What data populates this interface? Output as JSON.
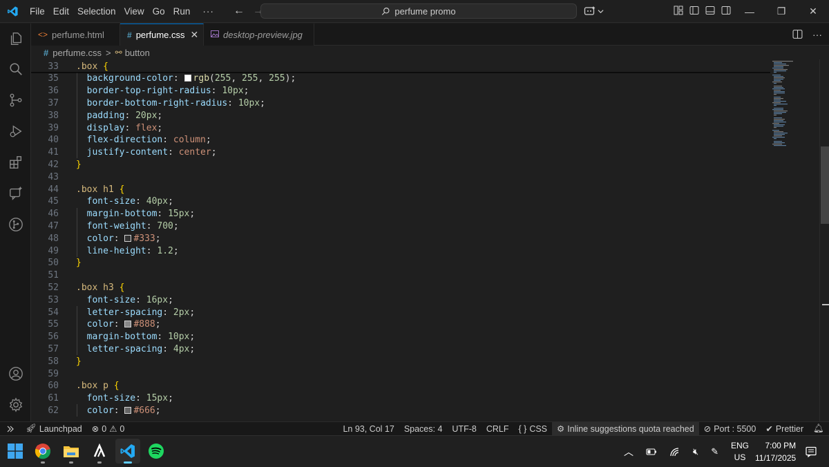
{
  "menu": [
    "File",
    "Edit",
    "Selection",
    "View",
    "Go",
    "Run"
  ],
  "menu_more": "···",
  "search": {
    "text": "perfume promo"
  },
  "tabs": [
    {
      "icon": "<>",
      "label": "perfume.html",
      "active": false
    },
    {
      "icon": "#",
      "label": "perfume.css",
      "active": true,
      "close": "✕"
    },
    {
      "icon": "img",
      "label": "desktop-preview.jpg",
      "active": false
    }
  ],
  "breadcrumb": {
    "icon": "#",
    "file": "perfume.css",
    "sep": ">",
    "symbol": "button"
  },
  "colors": {
    "accent": "#0078d4",
    "editor_bg": "#1f1f1f",
    "selector": "#d7ba7d",
    "property": "#9cdcfe",
    "value": "#ce9178",
    "number": "#b5cea8"
  },
  "code_lines": [
    {
      "n": "33",
      "sticky": true,
      "tokens": [
        [
          "sel",
          ".box "
        ],
        [
          "brace",
          "{"
        ]
      ]
    },
    {
      "n": "35",
      "tokens": [
        [
          "prop",
          "  background-color"
        ],
        [
          "punc",
          ": "
        ],
        [
          "swatch",
          "#ffffff"
        ],
        [
          "fn",
          "rgb"
        ],
        [
          "punc",
          "("
        ],
        [
          "num",
          "255"
        ],
        [
          "punc",
          ", "
        ],
        [
          "num",
          "255"
        ],
        [
          "punc",
          ", "
        ],
        [
          "num",
          "255"
        ],
        [
          "punc",
          ");"
        ]
      ]
    },
    {
      "n": "36",
      "tokens": [
        [
          "prop",
          "  border-top-right-radius"
        ],
        [
          "punc",
          ": "
        ],
        [
          "num",
          "10px"
        ],
        [
          "punc",
          ";"
        ]
      ]
    },
    {
      "n": "37",
      "tokens": [
        [
          "prop",
          "  border-bottom-right-radius"
        ],
        [
          "punc",
          ": "
        ],
        [
          "num",
          "10px"
        ],
        [
          "punc",
          ";"
        ]
      ]
    },
    {
      "n": "38",
      "tokens": [
        [
          "prop",
          "  padding"
        ],
        [
          "punc",
          ": "
        ],
        [
          "num",
          "20px"
        ],
        [
          "punc",
          ";"
        ]
      ]
    },
    {
      "n": "39",
      "tokens": [
        [
          "prop",
          "  display"
        ],
        [
          "punc",
          ": "
        ],
        [
          "val",
          "flex"
        ],
        [
          "punc",
          ";"
        ]
      ]
    },
    {
      "n": "40",
      "tokens": [
        [
          "prop",
          "  flex-direction"
        ],
        [
          "punc",
          ": "
        ],
        [
          "val",
          "column"
        ],
        [
          "punc",
          ";"
        ]
      ]
    },
    {
      "n": "41",
      "tokens": [
        [
          "prop",
          "  justify-content"
        ],
        [
          "punc",
          ": "
        ],
        [
          "val",
          "center"
        ],
        [
          "punc",
          ";"
        ]
      ]
    },
    {
      "n": "42",
      "tokens": [
        [
          "brace",
          "}"
        ]
      ]
    },
    {
      "n": "43",
      "tokens": []
    },
    {
      "n": "44",
      "tokens": [
        [
          "sel",
          ".box h1 "
        ],
        [
          "brace",
          "{"
        ]
      ]
    },
    {
      "n": "45",
      "tokens": [
        [
          "prop",
          "  font-size"
        ],
        [
          "punc",
          ": "
        ],
        [
          "num",
          "40px"
        ],
        [
          "punc",
          ";"
        ]
      ]
    },
    {
      "n": "46",
      "tokens": [
        [
          "prop",
          "  margin-bottom"
        ],
        [
          "punc",
          ": "
        ],
        [
          "num",
          "15px"
        ],
        [
          "punc",
          ";"
        ]
      ]
    },
    {
      "n": "47",
      "tokens": [
        [
          "prop",
          "  font-weight"
        ],
        [
          "punc",
          ": "
        ],
        [
          "num",
          "700"
        ],
        [
          "punc",
          ";"
        ]
      ]
    },
    {
      "n": "48",
      "tokens": [
        [
          "prop",
          "  color"
        ],
        [
          "punc",
          ": "
        ],
        [
          "swatch",
          "#333333"
        ],
        [
          "val",
          "#333"
        ],
        [
          "punc",
          ";"
        ]
      ]
    },
    {
      "n": "49",
      "tokens": [
        [
          "prop",
          "  line-height"
        ],
        [
          "punc",
          ": "
        ],
        [
          "num",
          "1.2"
        ],
        [
          "punc",
          ";"
        ]
      ]
    },
    {
      "n": "50",
      "tokens": [
        [
          "brace",
          "}"
        ]
      ]
    },
    {
      "n": "51",
      "tokens": []
    },
    {
      "n": "52",
      "tokens": [
        [
          "sel",
          ".box h3 "
        ],
        [
          "brace",
          "{"
        ]
      ]
    },
    {
      "n": "53",
      "tokens": [
        [
          "prop",
          "  font-size"
        ],
        [
          "punc",
          ": "
        ],
        [
          "num",
          "16px"
        ],
        [
          "punc",
          ";"
        ]
      ]
    },
    {
      "n": "54",
      "tokens": [
        [
          "prop",
          "  letter-spacing"
        ],
        [
          "punc",
          ": "
        ],
        [
          "num",
          "2px"
        ],
        [
          "punc",
          ";"
        ]
      ]
    },
    {
      "n": "55",
      "tokens": [
        [
          "prop",
          "  color"
        ],
        [
          "punc",
          ": "
        ],
        [
          "swatch",
          "#888888"
        ],
        [
          "val",
          "#888"
        ],
        [
          "punc",
          ";"
        ]
      ]
    },
    {
      "n": "56",
      "tokens": [
        [
          "prop",
          "  margin-bottom"
        ],
        [
          "punc",
          ": "
        ],
        [
          "num",
          "10px"
        ],
        [
          "punc",
          ";"
        ]
      ]
    },
    {
      "n": "57",
      "tokens": [
        [
          "prop",
          "  letter-spacing"
        ],
        [
          "punc",
          ": "
        ],
        [
          "num",
          "4px"
        ],
        [
          "punc",
          ";"
        ]
      ]
    },
    {
      "n": "58",
      "tokens": [
        [
          "brace",
          "}"
        ]
      ]
    },
    {
      "n": "59",
      "tokens": []
    },
    {
      "n": "60",
      "tokens": [
        [
          "sel",
          ".box p "
        ],
        [
          "brace",
          "{"
        ]
      ]
    },
    {
      "n": "61",
      "tokens": [
        [
          "prop",
          "  font-size"
        ],
        [
          "punc",
          ": "
        ],
        [
          "num",
          "15px"
        ],
        [
          "punc",
          ";"
        ]
      ]
    },
    {
      "n": "62",
      "tokens": [
        [
          "prop",
          "  color"
        ],
        [
          "punc",
          ": "
        ],
        [
          "swatch",
          "#666666"
        ],
        [
          "val",
          "#666"
        ],
        [
          "punc",
          ";"
        ]
      ]
    }
  ],
  "status": {
    "launchpad": "Launchpad",
    "errors": "0",
    "warnings": "0",
    "position": "Ln 93, Col 17",
    "spaces": "Spaces: 4",
    "encoding": "UTF-8",
    "eol": "CRLF",
    "language": "CSS",
    "copilot": "Inline suggestions quota reached",
    "port": "Port : 5500",
    "prettier": "Prettier"
  },
  "taskbar": {
    "lang_top": "ENG",
    "lang_bottom": "US",
    "time": "7:00 PM",
    "date": "11/17/2025"
  }
}
